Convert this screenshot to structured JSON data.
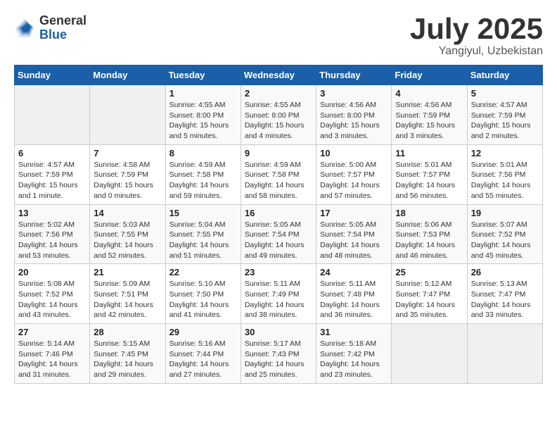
{
  "header": {
    "logo_general": "General",
    "logo_blue": "Blue",
    "title": "July 2025",
    "location": "Yangiyul, Uzbekistan"
  },
  "weekdays": [
    "Sunday",
    "Monday",
    "Tuesday",
    "Wednesday",
    "Thursday",
    "Friday",
    "Saturday"
  ],
  "weeks": [
    [
      {
        "day": "",
        "info": ""
      },
      {
        "day": "",
        "info": ""
      },
      {
        "day": "1",
        "info": "Sunrise: 4:55 AM\nSunset: 8:00 PM\nDaylight: 15 hours\nand 5 minutes."
      },
      {
        "day": "2",
        "info": "Sunrise: 4:55 AM\nSunset: 8:00 PM\nDaylight: 15 hours\nand 4 minutes."
      },
      {
        "day": "3",
        "info": "Sunrise: 4:56 AM\nSunset: 8:00 PM\nDaylight: 15 hours\nand 3 minutes."
      },
      {
        "day": "4",
        "info": "Sunrise: 4:56 AM\nSunset: 7:59 PM\nDaylight: 15 hours\nand 3 minutes."
      },
      {
        "day": "5",
        "info": "Sunrise: 4:57 AM\nSunset: 7:59 PM\nDaylight: 15 hours\nand 2 minutes."
      }
    ],
    [
      {
        "day": "6",
        "info": "Sunrise: 4:57 AM\nSunset: 7:59 PM\nDaylight: 15 hours\nand 1 minute."
      },
      {
        "day": "7",
        "info": "Sunrise: 4:58 AM\nSunset: 7:59 PM\nDaylight: 15 hours\nand 0 minutes."
      },
      {
        "day": "8",
        "info": "Sunrise: 4:59 AM\nSunset: 7:58 PM\nDaylight: 14 hours\nand 59 minutes."
      },
      {
        "day": "9",
        "info": "Sunrise: 4:59 AM\nSunset: 7:58 PM\nDaylight: 14 hours\nand 58 minutes."
      },
      {
        "day": "10",
        "info": "Sunrise: 5:00 AM\nSunset: 7:57 PM\nDaylight: 14 hours\nand 57 minutes."
      },
      {
        "day": "11",
        "info": "Sunrise: 5:01 AM\nSunset: 7:57 PM\nDaylight: 14 hours\nand 56 minutes."
      },
      {
        "day": "12",
        "info": "Sunrise: 5:01 AM\nSunset: 7:56 PM\nDaylight: 14 hours\nand 55 minutes."
      }
    ],
    [
      {
        "day": "13",
        "info": "Sunrise: 5:02 AM\nSunset: 7:56 PM\nDaylight: 14 hours\nand 53 minutes."
      },
      {
        "day": "14",
        "info": "Sunrise: 5:03 AM\nSunset: 7:55 PM\nDaylight: 14 hours\nand 52 minutes."
      },
      {
        "day": "15",
        "info": "Sunrise: 5:04 AM\nSunset: 7:55 PM\nDaylight: 14 hours\nand 51 minutes."
      },
      {
        "day": "16",
        "info": "Sunrise: 5:05 AM\nSunset: 7:54 PM\nDaylight: 14 hours\nand 49 minutes."
      },
      {
        "day": "17",
        "info": "Sunrise: 5:05 AM\nSunset: 7:54 PM\nDaylight: 14 hours\nand 48 minutes."
      },
      {
        "day": "18",
        "info": "Sunrise: 5:06 AM\nSunset: 7:53 PM\nDaylight: 14 hours\nand 46 minutes."
      },
      {
        "day": "19",
        "info": "Sunrise: 5:07 AM\nSunset: 7:52 PM\nDaylight: 14 hours\nand 45 minutes."
      }
    ],
    [
      {
        "day": "20",
        "info": "Sunrise: 5:08 AM\nSunset: 7:52 PM\nDaylight: 14 hours\nand 43 minutes."
      },
      {
        "day": "21",
        "info": "Sunrise: 5:09 AM\nSunset: 7:51 PM\nDaylight: 14 hours\nand 42 minutes."
      },
      {
        "day": "22",
        "info": "Sunrise: 5:10 AM\nSunset: 7:50 PM\nDaylight: 14 hours\nand 41 minutes."
      },
      {
        "day": "23",
        "info": "Sunrise: 5:11 AM\nSunset: 7:49 PM\nDaylight: 14 hours\nand 38 minutes."
      },
      {
        "day": "24",
        "info": "Sunrise: 5:11 AM\nSunset: 7:48 PM\nDaylight: 14 hours\nand 36 minutes."
      },
      {
        "day": "25",
        "info": "Sunrise: 5:12 AM\nSunset: 7:47 PM\nDaylight: 14 hours\nand 35 minutes."
      },
      {
        "day": "26",
        "info": "Sunrise: 5:13 AM\nSunset: 7:47 PM\nDaylight: 14 hours\nand 33 minutes."
      }
    ],
    [
      {
        "day": "27",
        "info": "Sunrise: 5:14 AM\nSunset: 7:46 PM\nDaylight: 14 hours\nand 31 minutes."
      },
      {
        "day": "28",
        "info": "Sunrise: 5:15 AM\nSunset: 7:45 PM\nDaylight: 14 hours\nand 29 minutes."
      },
      {
        "day": "29",
        "info": "Sunrise: 5:16 AM\nSunset: 7:44 PM\nDaylight: 14 hours\nand 27 minutes."
      },
      {
        "day": "30",
        "info": "Sunrise: 5:17 AM\nSunset: 7:43 PM\nDaylight: 14 hours\nand 25 minutes."
      },
      {
        "day": "31",
        "info": "Sunrise: 5:18 AM\nSunset: 7:42 PM\nDaylight: 14 hours\nand 23 minutes."
      },
      {
        "day": "",
        "info": ""
      },
      {
        "day": "",
        "info": ""
      }
    ]
  ]
}
